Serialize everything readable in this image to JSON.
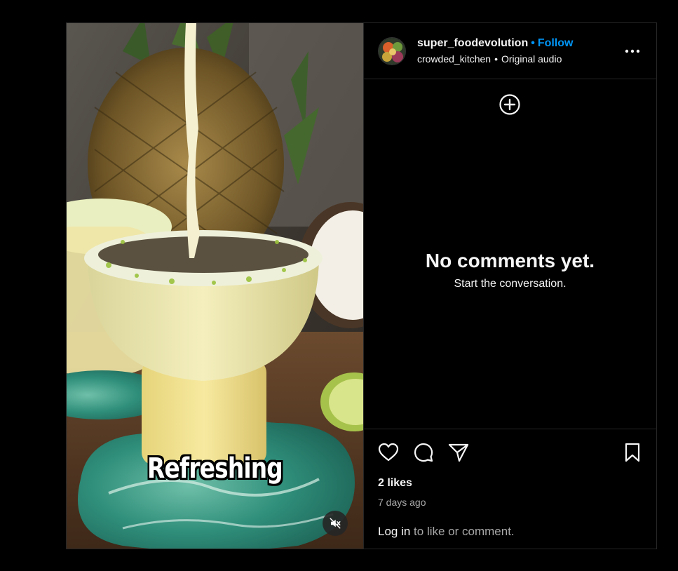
{
  "post": {
    "caption_overlay": "Refreshing",
    "mute_icon": "speaker-muted-icon"
  },
  "header": {
    "username": "super_foodevolution",
    "dot": "•",
    "follow_label": "Follow",
    "audio_user": "crowded_kitchen",
    "audio_sep": "•",
    "audio_label": "Original audio",
    "more_icon": "more-horizontal-icon"
  },
  "comments": {
    "add_icon": "plus-circle-icon",
    "empty_title": "No comments yet.",
    "empty_subtitle": "Start the conversation."
  },
  "footer": {
    "likes": "2 likes",
    "time": "7 days ago",
    "login_label": "Log in",
    "login_suffix": " to like or comment.",
    "icons": [
      "heart-icon",
      "comment-icon",
      "share-icon",
      "bookmark-icon"
    ]
  },
  "colors": {
    "accent": "#0095f6",
    "background": "#000000",
    "border": "#262626",
    "secondary_text": "#a8a8a8"
  }
}
